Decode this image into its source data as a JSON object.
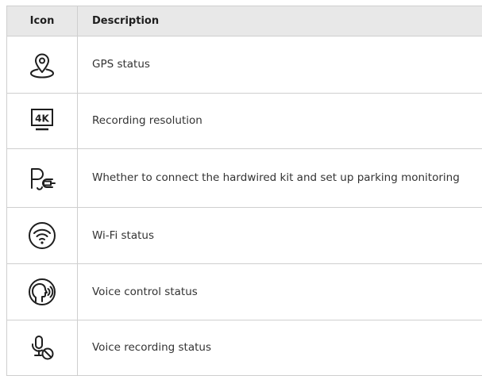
{
  "table": {
    "headers": {
      "icon": "Icon",
      "description": "Description"
    },
    "rows": [
      {
        "icon": "gps-pin-icon",
        "description": "GPS status"
      },
      {
        "icon": "resolution-4k-icon",
        "icon_text": "4K",
        "description": "Recording resolution"
      },
      {
        "icon": "parking-hardwire-icon",
        "description": "Whether to connect the hardwired kit and set up parking monitoring"
      },
      {
        "icon": "wifi-icon",
        "description": "Wi-Fi status"
      },
      {
        "icon": "voice-control-icon",
        "description": "Voice control status"
      },
      {
        "icon": "voice-recording-off-icon",
        "description": "Voice recording status"
      }
    ]
  },
  "colors": {
    "header_bg": "#e8e8e8",
    "border": "#cfcfcf",
    "icon_stroke": "#1e1e1e"
  }
}
